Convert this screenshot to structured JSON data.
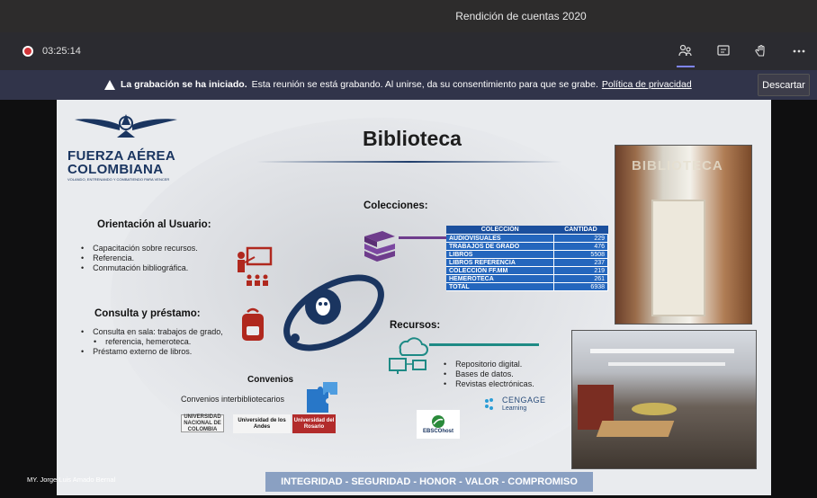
{
  "window": {
    "title": "Rendición de cuentas 2020"
  },
  "call": {
    "timer": "03:25:14"
  },
  "banner": {
    "bold_text": "La grabación se ha iniciado.",
    "message": "Esta reunión se está grabando. Al unirse, da su consentimiento para que se grabe.",
    "link": "Política de privacidad",
    "dismiss_label": "Descartar"
  },
  "slide": {
    "logo_line1": "FUERZA AÉREA",
    "logo_line2": "COLOMBIANA",
    "logo_tagline": "VOLANDO, ENTRENANDO Y COMBATIENDO PARA VENCER",
    "title": "Biblioteca",
    "orientacion": {
      "heading": "Orientación al Usuario:",
      "items": [
        "Capacitación sobre recursos.",
        "Referencia.",
        "Conmutación bibliográfica."
      ]
    },
    "consulta": {
      "heading": "Consulta y préstamo:",
      "items": [
        "Consulta en sala: trabajos de grado,",
        "referencia, hemeroteca.",
        "Préstamo externo de libros."
      ]
    },
    "colecciones": {
      "heading": "Colecciones:",
      "table_headers": [
        "COLECCIÓN",
        "CANTIDAD"
      ],
      "rows": [
        [
          "AUDIOVISUALES",
          "229"
        ],
        [
          "TRABAJOS DE GRADO",
          "476"
        ],
        [
          "LIBROS",
          "5508"
        ],
        [
          "LIBROS REFERENCIA",
          "237"
        ],
        [
          "COLECCIÓN FF.MM",
          "219"
        ],
        [
          "HEMEROTECA",
          "261"
        ],
        [
          "TOTAL",
          "6938"
        ]
      ]
    },
    "recursos": {
      "heading": "Recursos:",
      "items": [
        "Repositorio digital.",
        "Bases de datos.",
        "Revistas electrónicas."
      ]
    },
    "convenios": {
      "heading": "Convenios",
      "subtitle": "Convenios interbibliotecarios",
      "partners": [
        "UNIVERSIDAD NACIONAL DE COLOMBIA",
        "Universidad de los Andes",
        "Universidad del Rosario"
      ]
    },
    "vendors": {
      "ebsco": "EBSCOhost",
      "cengage_line1": "CENGAGE",
      "cengage_line2": "Learning"
    },
    "photo_sign": "BIBLIOTECA",
    "values_bar": "INTEGRIDAD - SEGURIDAD - HONOR - VALOR - COMPROMISO"
  },
  "presenter": {
    "name": "MY. Jorge Luis Amado Bernal"
  },
  "colors": {
    "accent_purple": "#7f85f5",
    "record_red": "#d13438",
    "table_blue": "#2466bd",
    "navy": "#1a3560"
  }
}
